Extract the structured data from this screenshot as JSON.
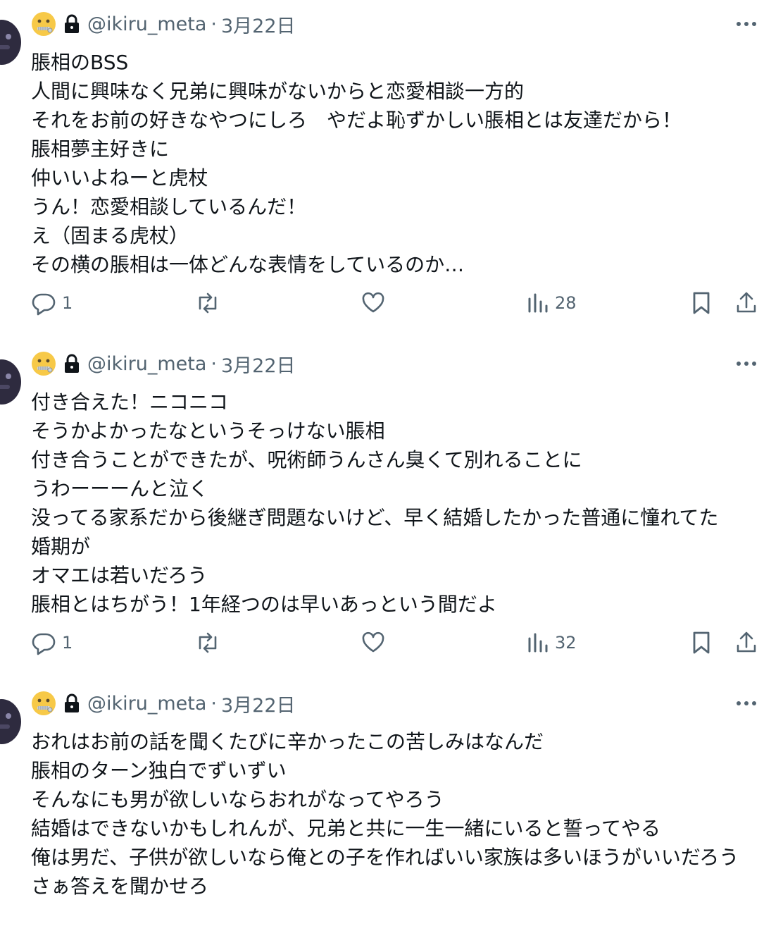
{
  "tweets": [
    {
      "handle": "@ikiru_meta",
      "separator": "·",
      "date": "3月22日",
      "lines": [
        "脹相のBSS",
        "人間に興味なく兄弟に興味がないからと恋愛相談一方的",
        "それをお前の好きなやつにしろ　やだよ恥ずかしい脹相とは友達だから！",
        "脹相夢主好きに",
        "仲いいよねーと虎杖",
        "うん！恋愛相談しているんだ！",
        "え（固まる虎杖）",
        "その横の脹相は一体どんな表情をしているのか…"
      ],
      "reply_count": "1",
      "views": "28"
    },
    {
      "handle": "@ikiru_meta",
      "separator": "·",
      "date": "3月22日",
      "lines": [
        "付き合えた！ニコニコ",
        "そうかよかったなというそっけない脹相",
        "付き合うことができたが、呪術師うんさん臭くて別れることに",
        "うわーーーんと泣く",
        "没ってる家系だから後継ぎ問題ないけど、早く結婚したかった普通に憧れてた　婚期が",
        "オマエは若いだろう",
        "脹相とはちがう！1年経つのは早いあっという間だよ"
      ],
      "reply_count": "1",
      "views": "32"
    },
    {
      "handle": "@ikiru_meta",
      "separator": "·",
      "date": "3月22日",
      "lines": [
        "おれはお前の話を聞くたびに辛かったこの苦しみはなんだ",
        "脹相のターン独白でずいずい",
        "そんなにも男が欲しいならおれがなってやろう",
        "結婚はできないかもしれんが、兄弟と共に一生一緒にいると誓ってやる",
        "俺は男だ、子供が欲しいなら俺との子を作ればいい家族は多いほうがいいだろう",
        "さぁ答えを聞かせろ"
      ]
    }
  ],
  "icons": {
    "emoji": "zipper-mouth-face-icon",
    "lock": "lock-icon",
    "more": "more-icon",
    "reply": "reply-icon",
    "repost": "repost-icon",
    "like": "like-icon",
    "views": "views-icon",
    "bookmark": "bookmark-icon",
    "share": "share-icon"
  },
  "colors": {
    "text": "#0f1419",
    "secondary": "#536471",
    "emoji": "#f7c948"
  }
}
